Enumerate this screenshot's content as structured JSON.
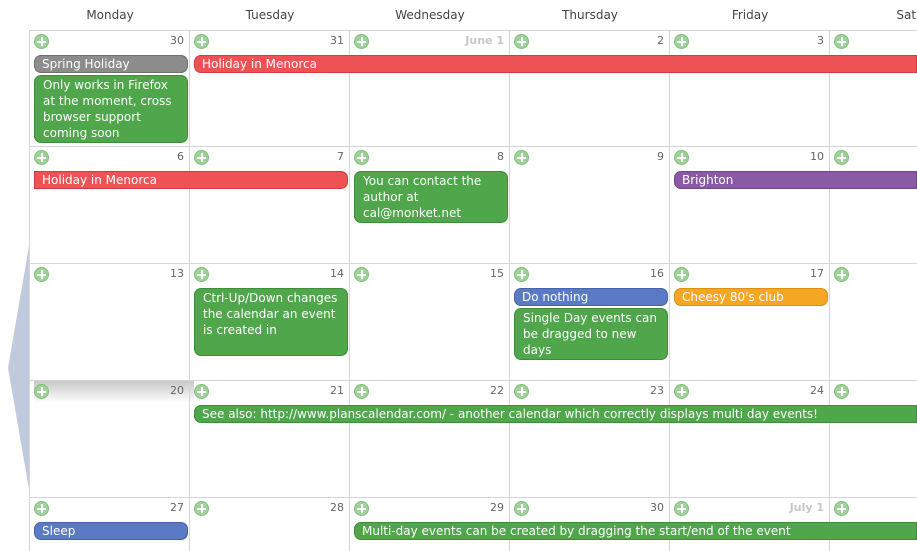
{
  "weekdays": [
    "Monday",
    "Tuesday",
    "Wednesday",
    "Thursday",
    "Friday",
    "Satu"
  ],
  "days": [
    {
      "label": "30",
      "month": false
    },
    {
      "label": "31",
      "month": false
    },
    {
      "label": "June 1",
      "month": true
    },
    {
      "label": "2",
      "month": false
    },
    {
      "label": "3",
      "month": false
    },
    {
      "label": "",
      "month": false
    },
    {
      "label": "6",
      "month": false
    },
    {
      "label": "7",
      "month": false
    },
    {
      "label": "8",
      "month": false
    },
    {
      "label": "9",
      "month": false
    },
    {
      "label": "10",
      "month": false
    },
    {
      "label": "",
      "month": false
    },
    {
      "label": "13",
      "month": false
    },
    {
      "label": "14",
      "month": false
    },
    {
      "label": "15",
      "month": false
    },
    {
      "label": "16",
      "month": false
    },
    {
      "label": "17",
      "month": false
    },
    {
      "label": "",
      "month": false
    },
    {
      "label": "20",
      "month": false
    },
    {
      "label": "21",
      "month": false
    },
    {
      "label": "22",
      "month": false
    },
    {
      "label": "23",
      "month": false
    },
    {
      "label": "24",
      "month": false
    },
    {
      "label": "",
      "month": false
    },
    {
      "label": "27",
      "month": false
    },
    {
      "label": "28",
      "month": false
    },
    {
      "label": "29",
      "month": false
    },
    {
      "label": "30",
      "month": false
    },
    {
      "label": "July 1",
      "month": true
    },
    {
      "label": "",
      "month": false
    }
  ],
  "events": [
    {
      "text": "Spring Holiday",
      "color": "gray",
      "row": 0,
      "col": 0,
      "span": 1,
      "slot": 0,
      "lines": 1,
      "rounded": "both"
    },
    {
      "text": "Holiday in Menorca",
      "color": "red",
      "row": 0,
      "col": 1,
      "span": 5,
      "slot": 0,
      "lines": 1,
      "rounded": "left"
    },
    {
      "text": "Only works in Firefox at the moment, cross browser support coming soon",
      "color": "green",
      "row": 0,
      "col": 0,
      "span": 1,
      "slot": 1,
      "lines": 4,
      "rounded": "both"
    },
    {
      "text": "Holiday in Menorca",
      "color": "red",
      "row": 1,
      "col": 0,
      "span": 2,
      "slot": 0,
      "lines": 1,
      "rounded": "right"
    },
    {
      "text": "You can contact the author at cal@monket.net",
      "color": "green",
      "row": 1,
      "col": 2,
      "span": 1,
      "slot": 0,
      "lines": 3,
      "rounded": "both"
    },
    {
      "text": "Brighton",
      "color": "purple",
      "row": 1,
      "col": 4,
      "span": 2,
      "slot": 0,
      "lines": 1,
      "rounded": "left"
    },
    {
      "text": "Ctrl-Up/Down changes the calendar an event is created in",
      "color": "green",
      "row": 2,
      "col": 1,
      "span": 1,
      "slot": 0,
      "lines": 4,
      "rounded": "both"
    },
    {
      "text": "Do nothing",
      "color": "blue",
      "row": 2,
      "col": 3,
      "span": 1,
      "slot": 0,
      "lines": 1,
      "rounded": "both"
    },
    {
      "text": "Cheesy 80's club",
      "color": "orange",
      "row": 2,
      "col": 4,
      "span": 1,
      "slot": 0,
      "lines": 1,
      "rounded": "both"
    },
    {
      "text": "Single Day events can be dragged to new days",
      "color": "green",
      "row": 2,
      "col": 3,
      "span": 1,
      "slot": 1,
      "lines": 3,
      "rounded": "both"
    },
    {
      "text": "See also: http://www.planscalendar.com/ - another calendar which correctly displays multi day events!",
      "color": "green",
      "row": 3,
      "col": 1,
      "span": 5,
      "slot": 0,
      "lines": 1,
      "rounded": "left"
    },
    {
      "text": "Sleep",
      "color": "blue",
      "row": 4,
      "col": 0,
      "span": 1,
      "slot": 0,
      "lines": 1,
      "rounded": "both"
    },
    {
      "text": "Multi-day events can be created by dragging the start/end of the event",
      "color": "green",
      "row": 4,
      "col": 2,
      "span": 4,
      "slot": 0,
      "lines": 1,
      "rounded": "left"
    }
  ]
}
